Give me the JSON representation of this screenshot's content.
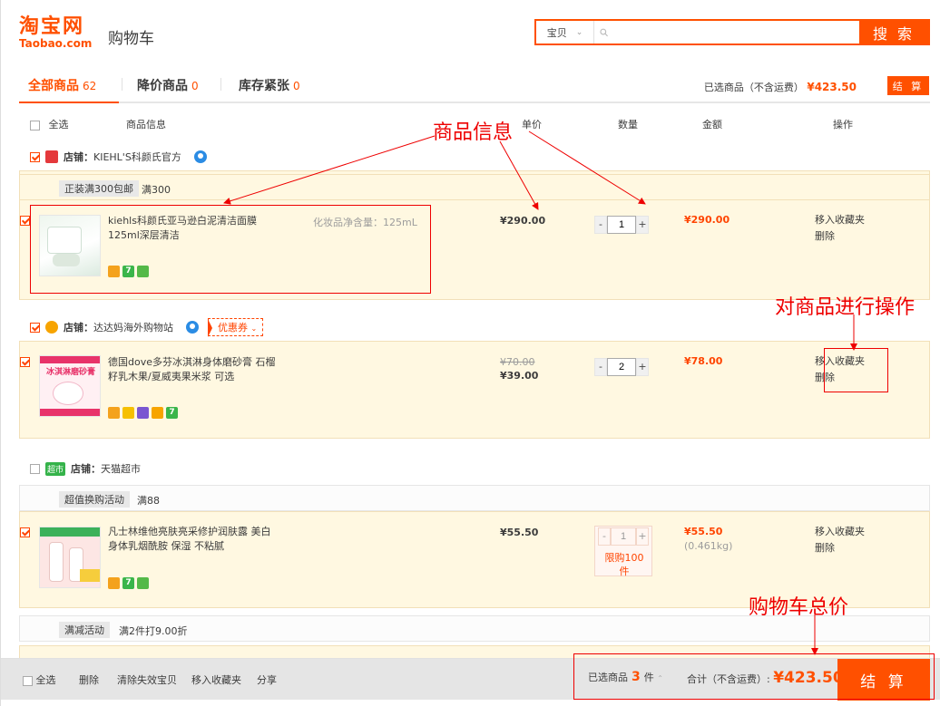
{
  "header": {
    "logo_cn": "淘宝网",
    "logo_en": "Taobao.com",
    "page_title": "购物车",
    "search_type": "宝贝",
    "search_button": "搜 索"
  },
  "tabs": [
    {
      "label": "全部商品",
      "count": "62"
    },
    {
      "label": "降价商品",
      "count": "0"
    },
    {
      "label": "库存紧张",
      "count": "0"
    }
  ],
  "summary_top": {
    "text": "已选商品（不含运费）",
    "amount": "¥423.50",
    "settle": "结 算"
  },
  "columns": {
    "select_all": "全选",
    "info": "商品信息",
    "price": "单价",
    "qty": "数量",
    "amount": "金额",
    "ops": "操作"
  },
  "shops": [
    {
      "prefix": "店铺：",
      "name": "KIEHL'S科颜氏官方",
      "checked": true,
      "promo_tag": "正装满300包邮",
      "promo_text": "满300",
      "items": [
        {
          "title": "kiehls科颜氏亚马逊白泥清洁面膜125ml深层清洁",
          "sku": "化妆品净含量：125mL",
          "price": "¥290.00",
          "qty": "1",
          "amount": "¥290.00",
          "op_fav": "移入收藏夹",
          "op_del": "删除"
        }
      ]
    },
    {
      "prefix": "店铺：",
      "name": "达达妈海外购物站",
      "coupon": "优惠券",
      "checked": true,
      "items": [
        {
          "title": "德国dove多芬冰淇淋身体磨砂膏 石榴籽乳木果/夏威夷果米浆 可选",
          "price_old": "¥70.00",
          "price": "¥39.00",
          "qty": "2",
          "amount": "¥78.00",
          "op_fav": "移入收藏夹",
          "op_del": "删除",
          "thumb_text": "冰淇淋磨砂膏"
        }
      ]
    },
    {
      "prefix": "店铺：",
      "name": "天猫超市",
      "badge": "超市",
      "checked": false,
      "promo_tag": "超值换购活动",
      "promo_text": "满88",
      "items": [
        {
          "title": "凡士林维他亮肤亮采修护润肤露 美白身体乳烟酰胺 保湿 不粘腻",
          "price": "¥55.50",
          "qty": "1",
          "limit": "限购100件",
          "amount": "¥55.50",
          "weight": "(0.461kg)",
          "op_fav": "移入收藏夹",
          "op_del": "删除"
        }
      ],
      "promo2_tag": "满减活动",
      "promo2_text": "满2件打9.00折"
    }
  ],
  "annotations": {
    "info": "商品信息",
    "ops": "对商品进行操作",
    "total": "购物车总价"
  },
  "footer": {
    "select_all": "全选",
    "delete": "删除",
    "clear_invalid": "清除失效宝贝",
    "move_fav": "移入收藏夹",
    "share": "分享",
    "selected_prefix": "已选商品",
    "selected_count": "3",
    "selected_unit": "件",
    "total_label": "合计（不含运费）:",
    "total_amount": "¥423.50",
    "settle": "结 算"
  },
  "colors": {
    "brand": "#ff5000",
    "annotation": "#ee0000",
    "item_bg": "#fff8e1"
  }
}
